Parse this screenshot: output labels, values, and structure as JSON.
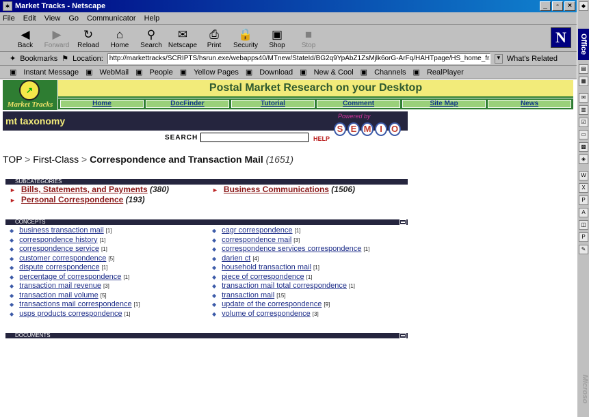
{
  "window": {
    "title": "Market Tracks - Netscape",
    "min": "_",
    "max": "▫",
    "close": "×"
  },
  "menu": [
    "File",
    "Edit",
    "View",
    "Go",
    "Communicator",
    "Help"
  ],
  "toolbar": [
    {
      "label": "Back",
      "icon": "◀",
      "disabled": false
    },
    {
      "label": "Forward",
      "icon": "▶",
      "disabled": true
    },
    {
      "label": "Reload",
      "icon": "↻",
      "disabled": false
    },
    {
      "label": "Home",
      "icon": "⌂",
      "disabled": false
    },
    {
      "label": "Search",
      "icon": "⚲",
      "disabled": false
    },
    {
      "label": "Netscape",
      "icon": "✉",
      "disabled": false
    },
    {
      "label": "Print",
      "icon": "⎙",
      "disabled": false
    },
    {
      "label": "Security",
      "icon": "🔒",
      "disabled": false
    },
    {
      "label": "Shop",
      "icon": "▣",
      "disabled": false
    },
    {
      "label": "Stop",
      "icon": "■",
      "disabled": true
    }
  ],
  "netscape_logo": "N",
  "location": {
    "bookmarks_label": "Bookmarks",
    "location_label": "Location:",
    "url": "http://markettracks/SCRIPTS/hsrun.exe/webapps40/MTnew/StateId/BG2q9YpAbZ1ZsMjlk6orG-ArFq/HAHTpage/HS_home_frame",
    "whats_related": "What's Related"
  },
  "personal_bar": [
    "Instant Message",
    "WebMail",
    "People",
    "Yellow Pages",
    "Download",
    "New & Cool",
    "Channels",
    "RealPlayer"
  ],
  "office": {
    "title": "Office",
    "ms": "Microso"
  },
  "site": {
    "logo_text": "Market Tracks",
    "banner": "Postal Market Research on your Desktop",
    "nav": [
      "Home",
      "DocFinder",
      "Tutorial",
      "Comment",
      "Site Map",
      "News"
    ],
    "taxonomy_title": "mt taxonomy",
    "search_label": "SEARCH",
    "search_value": "",
    "help_label": "HELP",
    "powered_by": "Powered by",
    "semio_letters": [
      "S",
      "E",
      "M",
      "I",
      "O"
    ]
  },
  "breadcrumb": {
    "top": "TOP",
    "sep": ">",
    "level1": "First-Class",
    "current": "Correspondence and Transaction Mail",
    "count": "(1651)"
  },
  "subcategories": {
    "header": "SUBCATEGORIES",
    "items": [
      {
        "label": "Bills, Statements, and Payments",
        "count": "(380)"
      },
      {
        "label": "Business Communications",
        "count": "(1506)"
      },
      {
        "label": "Personal Correspondence",
        "count": "(193)"
      }
    ]
  },
  "concepts": {
    "header": "CONCEPTS",
    "items": [
      {
        "label": "business transaction mail",
        "count": "[1]"
      },
      {
        "label": "cagr correspondence",
        "count": "[1]"
      },
      {
        "label": "correspondence history",
        "count": "[1]"
      },
      {
        "label": "correspondence mail",
        "count": "[3]"
      },
      {
        "label": "correspondence service",
        "count": "[1]"
      },
      {
        "label": "correspondence services correspondence",
        "count": "[1]"
      },
      {
        "label": "customer correspondence",
        "count": "[5]"
      },
      {
        "label": "darien ct",
        "count": "[4]"
      },
      {
        "label": "dispute correspondence",
        "count": "[1]"
      },
      {
        "label": "household transaction mail",
        "count": "[1]"
      },
      {
        "label": "percentage of correspondence",
        "count": "[1]"
      },
      {
        "label": "piece of correspondence",
        "count": "[1]"
      },
      {
        "label": "transaction mail revenue",
        "count": "[3]"
      },
      {
        "label": "transaction mail total correspondence",
        "count": "[1]"
      },
      {
        "label": "transaction mail volume",
        "count": "[5]"
      },
      {
        "label": "transaction mail",
        "count": "[15]"
      },
      {
        "label": "transactions mail correspondence",
        "count": "[1]"
      },
      {
        "label": "update of the correspondence",
        "count": "[9]"
      },
      {
        "label": "usps products correspondence",
        "count": "[1]"
      },
      {
        "label": "volume of correspondence",
        "count": "[3]"
      }
    ]
  },
  "documents": {
    "header": "DOCUMENTS"
  }
}
